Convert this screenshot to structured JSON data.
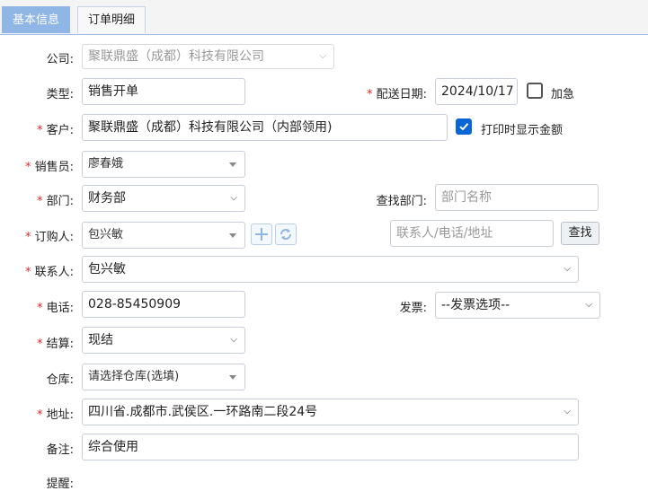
{
  "tabs": {
    "basic": "基本信息",
    "detail": "订单明细"
  },
  "form": {
    "company": {
      "label": "公司:",
      "value": "聚联鼎盛（成都）科技有限公司"
    },
    "type": {
      "label": "类型:",
      "value": "销售开单"
    },
    "delivery_date": {
      "required_mark": "*",
      "label": "配送日期:",
      "value": "2024/10/17"
    },
    "urgent": {
      "label": "加急",
      "checked": false
    },
    "customer": {
      "required_mark": "*",
      "label": "客户:",
      "value": "聚联鼎盛（成都）科技有限公司（内部领用)"
    },
    "print_amount": {
      "label": "打印时显示金额",
      "checked": true
    },
    "salesperson": {
      "required_mark": "*",
      "label": "销售员:",
      "value": "廖春娥"
    },
    "department": {
      "required_mark": "*",
      "label": "部门:",
      "value": "财务部"
    },
    "find_department": {
      "label": "查找部门:",
      "placeholder": "部门名称"
    },
    "orderer": {
      "required_mark": "*",
      "label": "订购人:",
      "value": "包兴敏"
    },
    "contact_search": {
      "placeholder": "联系人/电话/地址",
      "button": "查找"
    },
    "contact": {
      "required_mark": "*",
      "label": "联系人:",
      "value": "包兴敏"
    },
    "phone": {
      "required_mark": "*",
      "label": "电话:",
      "value": "028-85450909"
    },
    "invoice": {
      "label": "发票:",
      "value": "--发票选项--"
    },
    "settlement": {
      "required_mark": "*",
      "label": "结算:",
      "value": "现结"
    },
    "warehouse": {
      "label": "仓库:",
      "value": "请选择仓库(选填)"
    },
    "address": {
      "required_mark": "*",
      "label": "地址:",
      "value": "四川省.成都市.武侯区.一环路南二段24号"
    },
    "remark": {
      "label": "备注:",
      "value": "综合使用"
    },
    "reminder": {
      "label": "提醒:"
    }
  },
  "colors": {
    "accent": "#8fb6e4",
    "required": "#e5262a",
    "checkbox_on": "#0a66d6"
  }
}
